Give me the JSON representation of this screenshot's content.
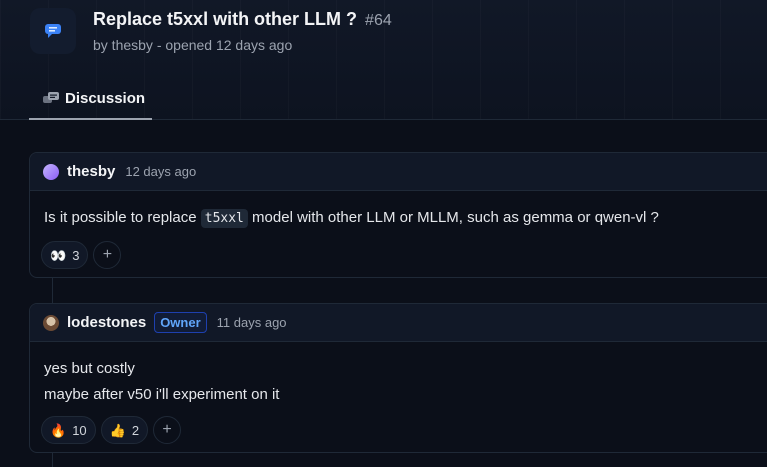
{
  "discussion": {
    "title": "Replace t5xxl with other LLM ?",
    "number": "#64",
    "subtitle": "by thesby - opened 12 days ago",
    "tab_label": "Discussion"
  },
  "comments": [
    {
      "author": "thesby",
      "time": "12 days ago",
      "text_before": "Is it possible to replace ",
      "code": "t5xxl",
      "text_after": " model with other LLM or MLLM, such as gemma or qwen-vl ?",
      "reactions": [
        {
          "emoji": "👀",
          "count": "3"
        }
      ],
      "add_reaction": "+"
    },
    {
      "author": "lodestones",
      "badge": "Owner",
      "time": "11 days ago",
      "lines": [
        "yes but costly",
        "maybe after v50 i'll experiment on it"
      ],
      "reactions": [
        {
          "emoji": "🔥",
          "count": "10"
        },
        {
          "emoji": "👍",
          "count": "2"
        }
      ],
      "add_reaction": "+"
    }
  ],
  "colors": {
    "background": "#0b0f19",
    "accent_blue": "#60a5fa",
    "discussion_icon": "#3b82f6"
  },
  "icons": [
    "discussion-icon",
    "discussion-tab-icon",
    "avatar",
    "eyes-emoji",
    "fire-emoji",
    "thumbs-up-emoji",
    "plus-icon"
  ]
}
